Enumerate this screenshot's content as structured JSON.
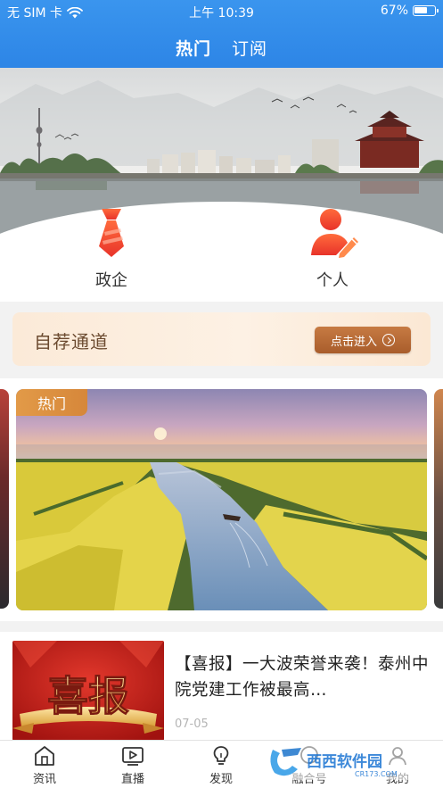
{
  "status_bar": {
    "carrier": "无 SIM 卡",
    "time": "上午 10:39",
    "battery": "67%",
    "battery_level": 0.67
  },
  "nav": {
    "tabs": [
      {
        "label": "热门",
        "active": true
      },
      {
        "label": "订阅",
        "active": false
      }
    ]
  },
  "categories": [
    {
      "label": "政企",
      "icon": "tie-icon"
    },
    {
      "label": "个人",
      "icon": "person-edit-icon"
    }
  ],
  "recommend": {
    "title": "自荐通道",
    "button_label": "点击进入"
  },
  "carousel": {
    "badge": "热门"
  },
  "news": {
    "title": "【喜报】一大波荣誉来袭！泰州中院党建工作被最高…",
    "thumb_text": "喜报",
    "date": "07-05"
  },
  "tabbar": {
    "items": [
      {
        "label": "资讯",
        "icon": "news-icon"
      },
      {
        "label": "直播",
        "icon": "live-icon"
      },
      {
        "label": "发现",
        "icon": "lightbulb-icon"
      },
      {
        "label": "融合号",
        "icon": "fusion-icon"
      },
      {
        "label": "我的",
        "icon": "profile-icon"
      }
    ]
  },
  "watermark": {
    "brand": "西西软件园",
    "domain": "CR173.COM"
  },
  "colors": {
    "header_blue": "#2d85e6",
    "accent_orange": "#d6873a",
    "recommend_button": "#b5652f"
  }
}
